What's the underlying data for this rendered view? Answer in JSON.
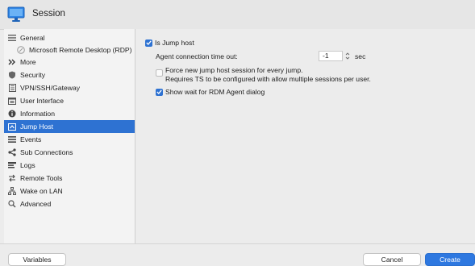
{
  "window": {
    "title": "Session",
    "icon": "monitor-icon"
  },
  "sidebar": {
    "items": [
      {
        "label": "General",
        "icon": "list-lines-icon"
      },
      {
        "label": "Microsoft Remote Desktop (RDP)",
        "icon": "rdp-circle-icon"
      },
      {
        "label": "More",
        "icon": "double-chevron-icon"
      },
      {
        "label": "Security",
        "icon": "shield-icon"
      },
      {
        "label": "VPN/SSH/Gateway",
        "icon": "vpn-document-icon"
      },
      {
        "label": "User Interface",
        "icon": "window-icon"
      },
      {
        "label": "Information",
        "icon": "info-icon"
      },
      {
        "label": "Jump Host",
        "icon": "jump-host-icon",
        "selected": true
      },
      {
        "label": "Events",
        "icon": "events-lines-icon"
      },
      {
        "label": "Sub Connections",
        "icon": "share-icon"
      },
      {
        "label": "Logs",
        "icon": "logs-icon"
      },
      {
        "label": "Remote Tools",
        "icon": "swap-arrows-icon"
      },
      {
        "label": "Wake on LAN",
        "icon": "network-icon"
      },
      {
        "label": "Advanced",
        "icon": "magnifier-icon"
      }
    ]
  },
  "jump_host": {
    "is_jump_host": {
      "label": "Is Jump host",
      "checked": true
    },
    "agent_timeout": {
      "label": "Agent connection time out:",
      "value": "-1",
      "unit": "sec"
    },
    "force_new_session": {
      "line1": "Force new jump host session for every jump.",
      "line2": "Requires TS to be configured with allow multiple sessions per user.",
      "checked": false
    },
    "show_wait": {
      "label": "Show wait for RDM Agent dialog",
      "checked": true
    }
  },
  "footer": {
    "variables_label": "Variables",
    "cancel_label": "Cancel",
    "create_label": "Create"
  },
  "colors": {
    "accent": "#2e72d2",
    "selection": "#2e72d2"
  }
}
